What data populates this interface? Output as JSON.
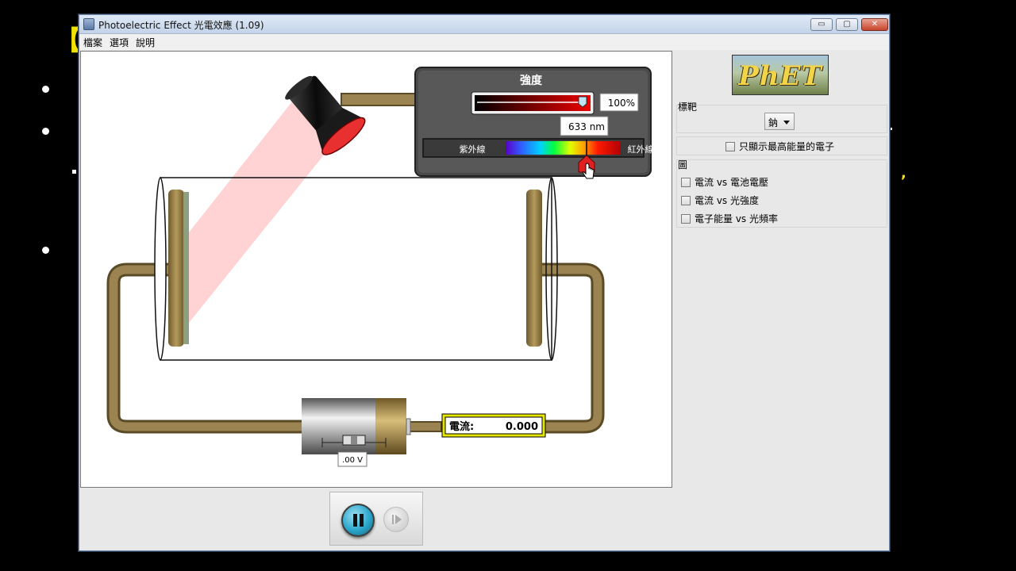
{
  "background": {
    "bracket_text": "【"
  },
  "window": {
    "title": "Photoelectric Effect 光電效應 (1.09)",
    "controls": {
      "minimize": "▭",
      "maximize": "▢",
      "close": "✕"
    }
  },
  "menu": [
    {
      "label": "檔案"
    },
    {
      "label": "選項"
    },
    {
      "label": "說明"
    }
  ],
  "sim": {
    "intensity_panel": {
      "title": "強度",
      "intensity_value": "100%",
      "wavelength_value": "633 nm",
      "uv_label": "紫外線",
      "ir_label": "紅外線",
      "intensity_percent": 100,
      "wavelength_nm": 633
    },
    "ammeter": {
      "label": "電流:",
      "value": "0.000"
    },
    "battery": {
      "voltage_label": ".00 V"
    },
    "colors": {
      "wire": "#8b7748",
      "light_beam": "#ff9d9d",
      "lamp_ring": "#e83030",
      "ammeter_border": "#e6e600"
    }
  },
  "controls": {
    "pause_icon": "pause-icon",
    "step_icon": "step-icon"
  },
  "side_panel": {
    "logo_text": "PhET",
    "target": {
      "title": "標靶",
      "selected": "鈉"
    },
    "highest_energy_only": "只顯示最高能量的電子",
    "graphs": {
      "title": "圖",
      "items": [
        {
          "label": "電流 vs 電池電壓"
        },
        {
          "label": "電流 vs 光強度"
        },
        {
          "label": "電子能量 vs 光頻率"
        }
      ]
    }
  }
}
